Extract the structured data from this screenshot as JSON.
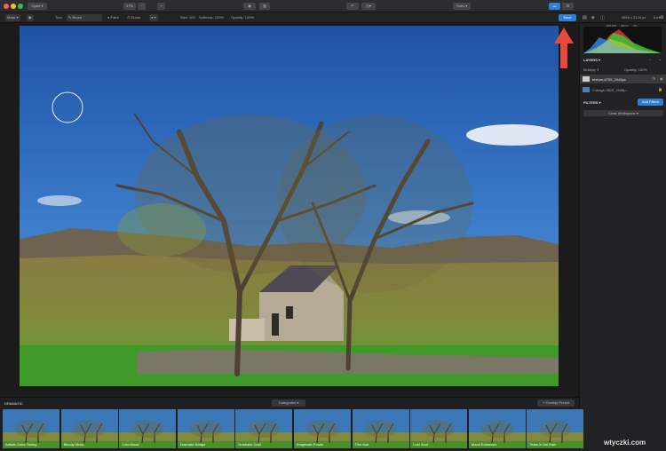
{
  "titlebar": {
    "open_label": "Open",
    "zoom_label": "27%",
    "tools_label": "Tools"
  },
  "toolbar": {
    "mask_label": "Mask",
    "tool_label": "Tool:",
    "brush_label": "Brush",
    "paint_label": "Paint",
    "erase_label": "Erase",
    "size_label": "Size: 100",
    "softness_label": "Softness: 100%",
    "opacity_label": "Opacity: 100%",
    "save_label": "Save",
    "dims_label": "3616 x 3144 px",
    "bits_label": "8-bit"
  },
  "panel": {
    "histogram_labels": [
      "ISO 100",
      "18mm",
      "f/11"
    ],
    "layers_label": "LAYERS",
    "blend_label": "Multiply",
    "opacity_label": "Opacity: 100%",
    "layer1_name": "texture-6709_2048px",
    "layer2_name": "Cottage-9823_2048p...",
    "filters_label": "FILTERS",
    "add_filters_label": "Add Filters",
    "clear_workspace_label": "Clear Workspace"
  },
  "bottom": {
    "category_label": "DRAMATIC",
    "categories_btn": "Categories",
    "overlay_btn": "+ Overlay Preset",
    "presets": [
      "Artistic Color Toning",
      "Bloody Misty",
      "Cold Mood",
      "Dramatic Bridge",
      "Dramatic Cold",
      "Enigmatic Power",
      "Film Noir",
      "Lost Soul",
      "Mood Enhancer",
      "Tears in the Rain"
    ]
  },
  "watermark": "wtyczki.com",
  "colors": {
    "accent": "#2f7fd8",
    "arrow": "#e8483b"
  }
}
